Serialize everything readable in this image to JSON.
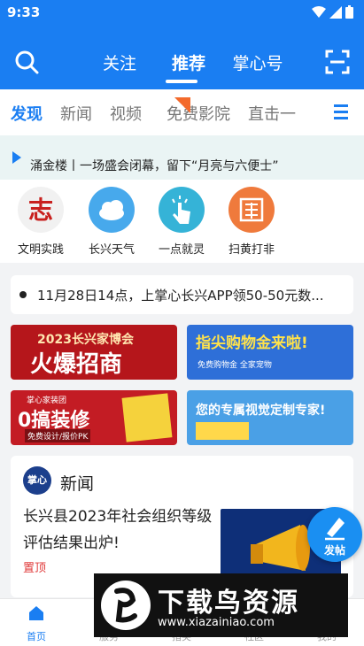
{
  "status": {
    "time": "9:33"
  },
  "top_tabs": [
    "关注",
    "推荐",
    "掌心号"
  ],
  "categories": [
    "发现",
    "新闻",
    "视频",
    "免费影院",
    "直击一"
  ],
  "notice": {
    "text": "涌金楼丨一场盛会闭幕，留下“月亮与六便士”"
  },
  "quick_links": [
    {
      "label": "文明实践",
      "icon": "civilization-icon"
    },
    {
      "label": "长兴天气",
      "icon": "weather-icon"
    },
    {
      "label": "一点就灵",
      "icon": "tap-icon"
    },
    {
      "label": "扫黄打非",
      "icon": "anti-pornography-icon"
    }
  ],
  "ticker": {
    "text": "11月28日14点，上掌心长兴APP领50-50元数..."
  },
  "banners": [
    {
      "line1": "2023长兴家博会",
      "line2": "火爆招商"
    },
    {
      "line1": "指尖购物金来啦!",
      "line2": "免费购物金 全家宠物"
    },
    {
      "line1": "掌心家装团",
      "line2": "0搞装修",
      "line3": "免费设计/报价PK"
    },
    {
      "line1": "您的专属视觉定制专家!"
    }
  ],
  "news": {
    "section": "新闻",
    "logo": "掌心",
    "headline": "长兴县2023年社会组织等级评估结果出炉!",
    "pin": "置顶"
  },
  "fab": {
    "label": "发帖"
  },
  "bottom_nav": [
    "首页",
    "服务",
    "指尖",
    "社区",
    "我的"
  ],
  "watermark": {
    "title": "下载鸟资源",
    "url": "www.xiazainiao.com"
  },
  "colors": {
    "primary": "#1a7ef2",
    "pin": "#e03a3a"
  }
}
